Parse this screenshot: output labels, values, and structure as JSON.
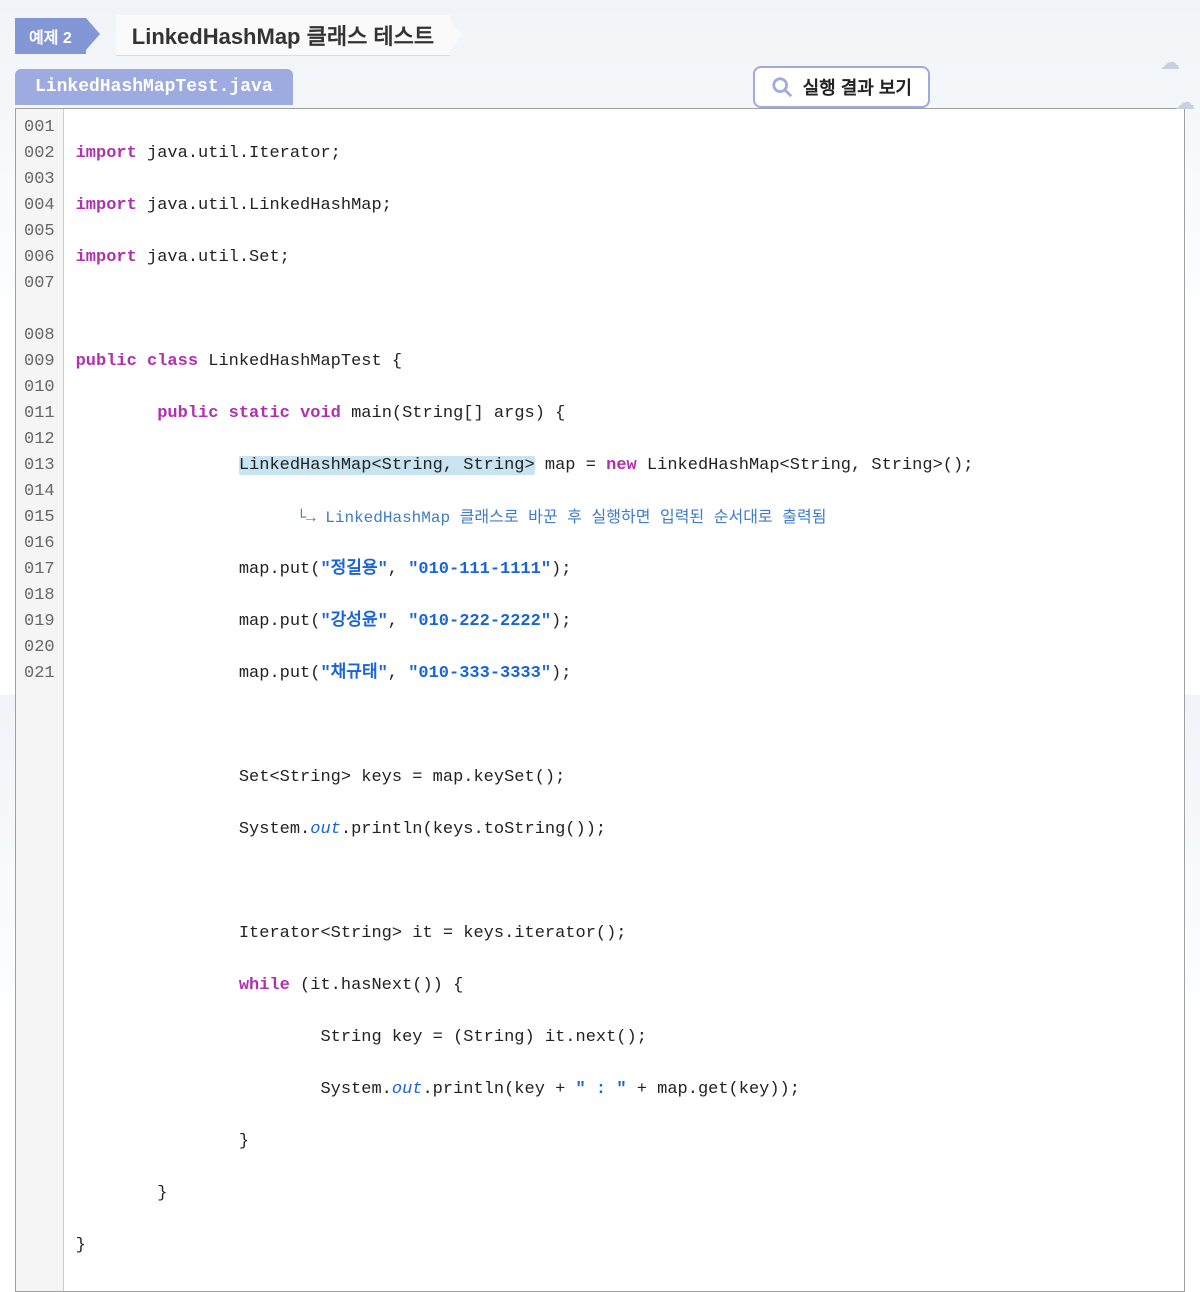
{
  "header": {
    "badge": "예제 2",
    "title": "LinkedHashMap 클래스 테스트"
  },
  "file_tab": "LinkedHashMapTest.java",
  "run_button": "실행 결과 보기",
  "annotation": "LinkedHashMap 클래스로 바꾼 후 실행하면 입력된 순서대로 출력됨",
  "code": {
    "line_numbers": [
      "001",
      "002",
      "003",
      "004",
      "005",
      "006",
      "007",
      "",
      "008",
      "009",
      "010",
      "011",
      "012",
      "013",
      "014",
      "015",
      "016",
      "017",
      "018",
      "019",
      "020",
      "021"
    ],
    "l1_kw": "import",
    "l1_rest": " java.util.Iterator;",
    "l2_kw": "import",
    "l2_rest": " java.util.LinkedHashMap;",
    "l3_kw": "import",
    "l3_rest": " java.util.Set;",
    "l5_kw1": "public",
    "l5_kw2": "class",
    "l5_rest": " LinkedHashMapTest {",
    "l6_kw1": "public",
    "l6_kw2": "static",
    "l6_kw3": "void",
    "l6_rest": " main(String[] args) {",
    "l7_hl": "LinkedHashMap<String, String>",
    "l7_mid": " map = ",
    "l7_kw": "new",
    "l7_rest": " LinkedHashMap<String, String>();",
    "l8_pre": "map.put(",
    "l8_s1": "\"정길용\"",
    "l8_mid": ", ",
    "l8_s2": "\"010-111-1111\"",
    "l8_post": ");",
    "l9_pre": "map.put(",
    "l9_s1": "\"강성윤\"",
    "l9_mid": ", ",
    "l9_s2": "\"010-222-2222\"",
    "l9_post": ");",
    "l10_pre": "map.put(",
    "l10_s1": "\"채규태\"",
    "l10_mid": ", ",
    "l10_s2": "\"010-333-3333\"",
    "l10_post": ");",
    "l12": "Set<String> keys = map.keySet();",
    "l13_pre": "System.",
    "l13_out": "out",
    "l13_post": ".println(keys.toString());",
    "l15": "Iterator<String> it = keys.iterator();",
    "l16_kw": "while",
    "l16_rest": " (it.hasNext()) {",
    "l17": "String key = (String) it.next();",
    "l18_pre": "System.",
    "l18_out": "out",
    "l18_mid": ".println(key + ",
    "l18_s": "\" : \"",
    "l18_post": " + map.get(key));",
    "l19": "}",
    "l20": "}",
    "l21": "}"
  }
}
